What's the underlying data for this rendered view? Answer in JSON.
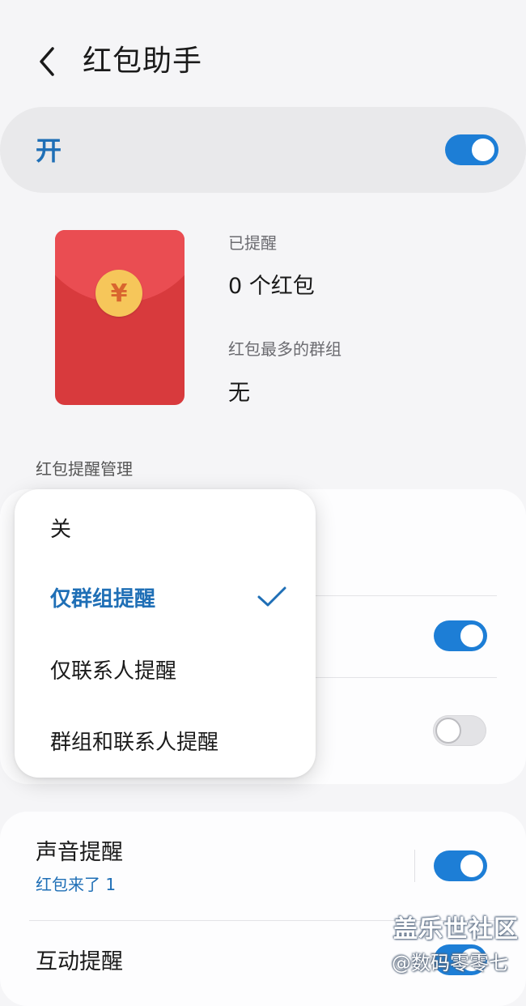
{
  "header": {
    "title": "红包助手",
    "back_icon": "chevron-left-icon"
  },
  "master_switch": {
    "label": "开",
    "on": true
  },
  "stats": {
    "reminded_label": "已提醒",
    "reminded_value": "0 个红包",
    "top_group_label": "红包最多的群组",
    "top_group_value": "无",
    "envelope_icon": "red-envelope-icon",
    "coin_symbol": "¥"
  },
  "management": {
    "section_title": "红包提醒管理",
    "row2_toggle_on": true,
    "row3_toggle_on": false
  },
  "popup_menu": {
    "items": [
      {
        "label": "关",
        "selected": false
      },
      {
        "label": "仅群组提醒",
        "selected": true
      },
      {
        "label": "仅联系人提醒",
        "selected": false
      },
      {
        "label": "群组和联系人提醒",
        "selected": false
      }
    ],
    "check_icon": "checkmark-icon"
  },
  "bottom": {
    "sound": {
      "title": "声音提醒",
      "subtitle": "红包来了 1",
      "on": true
    },
    "interaction": {
      "title": "互动提醒",
      "on": true
    }
  },
  "watermark": {
    "line1": "盖乐世社区",
    "line2": "@数码零零七"
  },
  "colors": {
    "accent": "#1d7ed6",
    "envelope_red": "#d83a3d",
    "coin_gold": "#f6c65a"
  }
}
